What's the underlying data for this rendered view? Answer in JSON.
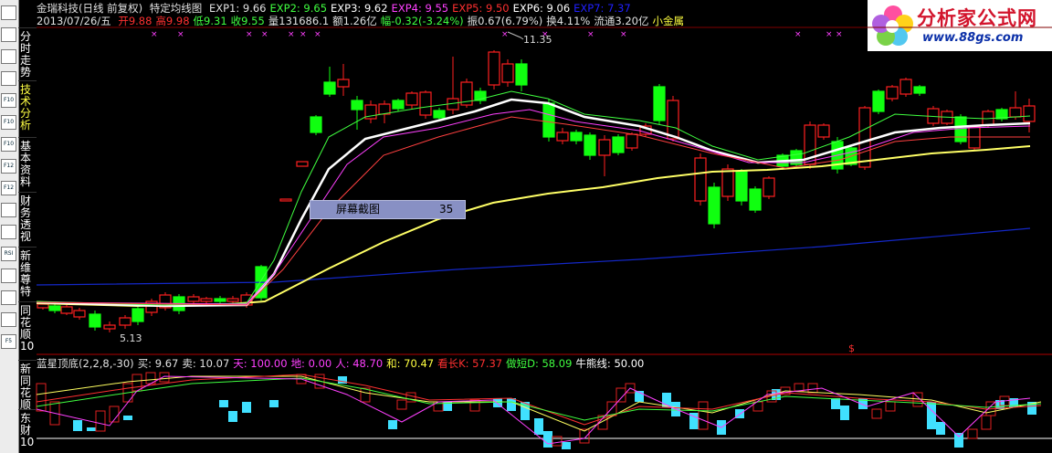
{
  "sidebar": {
    "icons": [
      "bars-icon",
      "grid-icon",
      "chart-icon",
      "candles-icon",
      "f10-icon",
      "f10-icon",
      "f10-icon",
      "f12-icon",
      "f12-icon",
      "menu-icon",
      "bars2-icon",
      "rsi-icon",
      "warning-icon",
      "lightning-icon",
      "menu2-icon",
      "f5-icon"
    ],
    "icon_text": [
      "",
      "",
      "",
      "",
      "F10",
      "F10",
      "F10",
      "F12",
      "F12",
      "",
      "",
      "RSI",
      "",
      "",
      "",
      "F5"
    ],
    "tabs": [
      "分时走势",
      "技术分析",
      "基本资料",
      "财务透视",
      "新维尊特",
      "同花顺10",
      "新同花顺",
      "东财10"
    ]
  },
  "header": {
    "stock": "金瑞科技(日线 前复权)",
    "indicator_name": "特定均线图",
    "exps": [
      {
        "label": "EXP1: 9.66",
        "color": "#e0e0e0"
      },
      {
        "label": "EXP2: 9.65",
        "color": "#40ff40"
      },
      {
        "label": "EXP3: 9.62",
        "color": "#ffffff"
      },
      {
        "label": "EXP4: 9.55",
        "color": "#ff40ff"
      },
      {
        "label": "EXP5: 9.50",
        "color": "#ff3030"
      },
      {
        "label": "EXP6: 9.06",
        "color": "#ffffff"
      },
      {
        "label": "EXP7: 7.37",
        "color": "#2020ff"
      }
    ],
    "date": "2013/07/26/五",
    "quote": [
      {
        "label": "开9.88",
        "color": "#ff3030"
      },
      {
        "label": "高9.98",
        "color": "#ff3030"
      },
      {
        "label": "低9.31",
        "color": "#40ff40"
      },
      {
        "label": "收9.55",
        "color": "#40ff40"
      },
      {
        "label": "量131686.1",
        "color": "#e0e0e0"
      },
      {
        "label": "额1.26亿",
        "color": "#e0e0e0"
      },
      {
        "label": "幅-0.32(-3.24%)",
        "color": "#40ff40"
      },
      {
        "label": "振0.67(6.79%)",
        "color": "#e0e0e0"
      },
      {
        "label": "换4.11%",
        "color": "#e0e0e0"
      },
      {
        "label": "流通3.20亿",
        "color": "#e0e0e0"
      },
      {
        "label": "小金属",
        "color": "#ffff40"
      }
    ]
  },
  "logo": {
    "brand": "分析家公式网",
    "url": "www.88gs.com"
  },
  "popup": {
    "label": "屏幕截图",
    "value": "35"
  },
  "annotations": {
    "high": "11.35",
    "low": "5.13",
    "signal": "$"
  },
  "sub_header": [
    {
      "label": "蓝星顶底(2,2,8,-30)",
      "color": "#e0e0e0"
    },
    {
      "label": "买: 9.67",
      "color": "#e0e0e0"
    },
    {
      "label": "卖: 10.07",
      "color": "#e0e0e0"
    },
    {
      "label": "天: 100.00",
      "color": "#ff40ff"
    },
    {
      "label": "地: 0.00",
      "color": "#ff40ff"
    },
    {
      "label": "人: 48.70",
      "color": "#ff40ff"
    },
    {
      "label": "和: 70.47",
      "color": "#ffff40"
    },
    {
      "label": "看长K: 57.37",
      "color": "#ff3030"
    },
    {
      "label": "做短D: 58.09",
      "color": "#40ff40"
    },
    {
      "label": "牛熊线: 50.00",
      "color": "#ffffff"
    }
  ],
  "colors": {
    "up": "#ff2020",
    "down": "#10ff10",
    "ma_white": "#ffffff",
    "ma_yellow": "#ffff60",
    "ma_blue": "#1020d0",
    "hist": "#40e0ff"
  }
}
